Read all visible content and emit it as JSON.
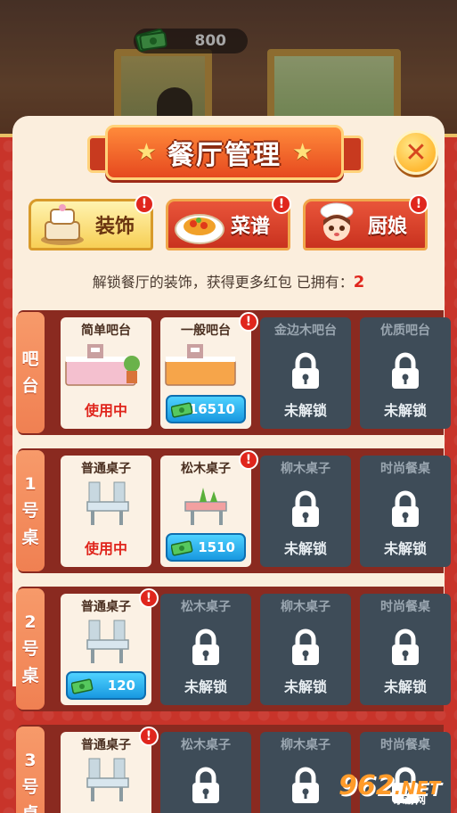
{
  "hud": {
    "money": "800",
    "money_icon": "cash-stack-icon"
  },
  "dialog": {
    "title": "餐厅管理",
    "title_star": "★",
    "close_icon": "close-icon",
    "close_glyph": "✕"
  },
  "tabs": [
    {
      "label": "装饰",
      "icon": "cake-stand-icon",
      "active": true,
      "badge": "!"
    },
    {
      "label": "菜谱",
      "icon": "dish-icon",
      "active": false,
      "badge": "!"
    },
    {
      "label": "厨娘",
      "icon": "chef-girl-icon",
      "active": false,
      "badge": "!"
    }
  ],
  "info": {
    "text": "解锁餐厅的装饰，获得更多红包  已拥有：",
    "owned": "2"
  },
  "rows": [
    {
      "label": [
        "吧",
        "台"
      ],
      "items": [
        {
          "name": "简单吧台",
          "state": "使用中",
          "locked": false,
          "badge": false,
          "art": "simple-bar-icon"
        },
        {
          "name": "一般吧台",
          "state": "",
          "price": "16510",
          "locked": false,
          "badge": true,
          "art": "normal-bar-icon"
        },
        {
          "name": "金边木吧台",
          "state": "未解锁",
          "locked": true,
          "badge": false
        },
        {
          "name": "优质吧台",
          "state": "未解锁",
          "locked": true,
          "badge": false
        }
      ]
    },
    {
      "label": [
        "1",
        "号",
        "桌"
      ],
      "items": [
        {
          "name": "普通桌子",
          "state": "使用中",
          "locked": false,
          "badge": false,
          "art": "plain-table-icon"
        },
        {
          "name": "松木桌子",
          "state": "",
          "price": "1510",
          "locked": false,
          "badge": true,
          "art": "pine-table-icon"
        },
        {
          "name": "柳木桌子",
          "state": "未解锁",
          "locked": true,
          "badge": false
        },
        {
          "name": "时尚餐桌",
          "state": "未解锁",
          "locked": true,
          "badge": false
        }
      ]
    },
    {
      "label": [
        "2",
        "号",
        "桌"
      ],
      "items": [
        {
          "name": "普通桌子",
          "state": "",
          "price": "120",
          "locked": false,
          "badge": true,
          "art": "plain-table-icon"
        },
        {
          "name": "松木桌子",
          "state": "未解锁",
          "locked": true,
          "badge": false
        },
        {
          "name": "柳木桌子",
          "state": "未解锁",
          "locked": true,
          "badge": false
        },
        {
          "name": "时尚餐桌",
          "state": "未解锁",
          "locked": true,
          "badge": false
        }
      ]
    },
    {
      "label": [
        "3",
        "号",
        "桌"
      ],
      "items": [
        {
          "name": "普通桌子",
          "state": "",
          "locked": false,
          "badge": true,
          "art": "plain-table-icon"
        },
        {
          "name": "松木桌子",
          "state": "",
          "locked": true,
          "badge": false
        },
        {
          "name": "柳木桌子",
          "state": "",
          "locked": true,
          "badge": false
        },
        {
          "name": "时尚餐桌",
          "state": "",
          "locked": true,
          "badge": false
        }
      ]
    }
  ],
  "watermark": {
    "logo": "962",
    "suffix": ".NET",
    "sub": "乐游网"
  },
  "colors": {
    "panel": "#c8342a",
    "accent_red": "#e0261d",
    "price_blue": "#1898e0",
    "locked_card": "#3e4c58"
  }
}
